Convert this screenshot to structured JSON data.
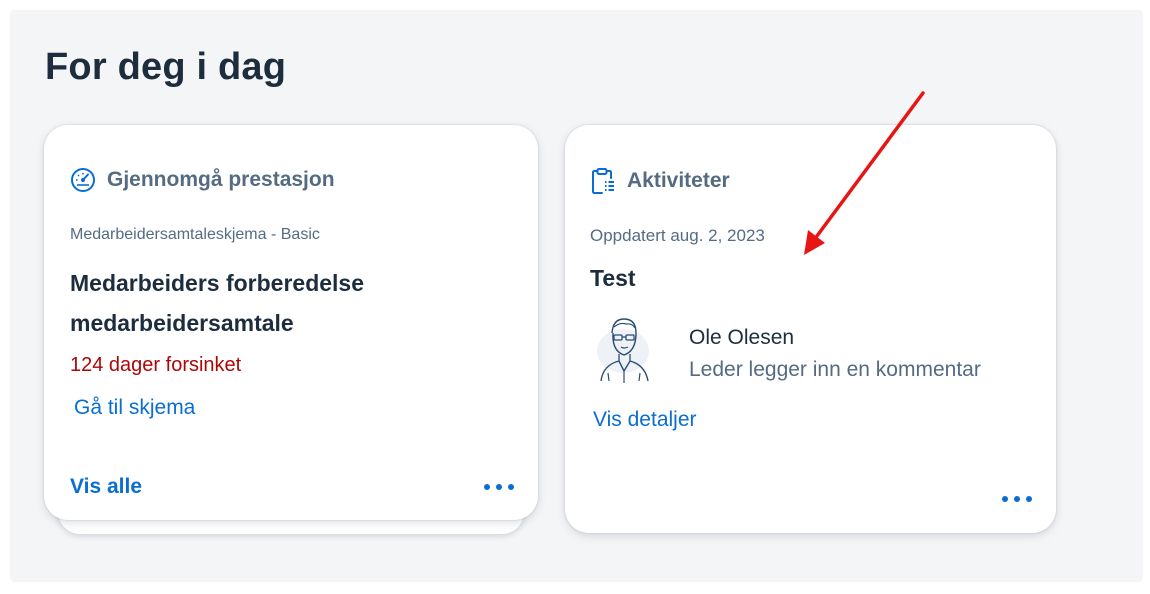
{
  "page": {
    "section_title": "For deg i dag"
  },
  "cards": [
    {
      "header": "Gjennomgå prestasjon",
      "header_icon": "gauge-icon",
      "subtitle": "Medarbeidersamtaleskjema - Basic",
      "title": "Medarbeiders forberedelse medarbeidersamtale",
      "status": "124 dager forsinket",
      "link": "Gå til skjema",
      "footer_link": "Vis alle"
    },
    {
      "header": "Aktiviteter",
      "header_icon": "clipboard-list-icon",
      "subtitle": "Oppdatert aug. 2, 2023",
      "title": "Test",
      "person_name": "Ole Olesen",
      "person_role": "Leder legger inn en kommentar",
      "link": "Vis detaljer"
    }
  ],
  "colors": {
    "accent": "#0a6ed1",
    "title": "#1d2d3e",
    "secondary_text": "#556b82",
    "error": "#aa0808",
    "annotation_arrow": "#e81515"
  }
}
